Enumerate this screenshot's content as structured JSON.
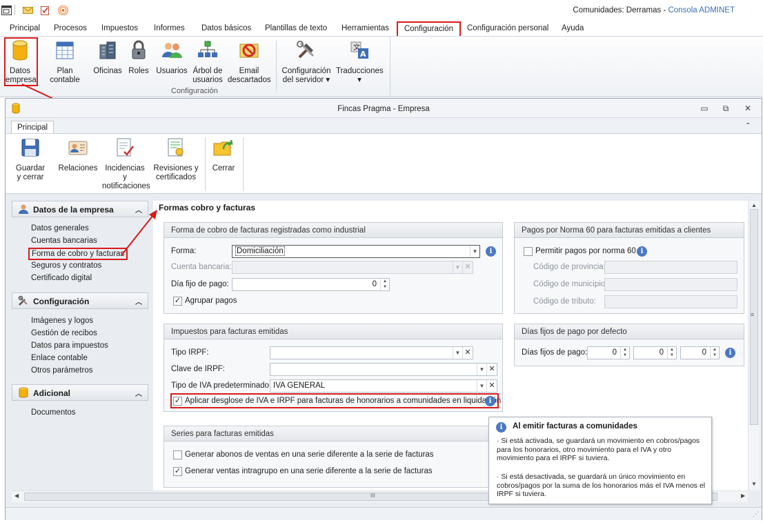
{
  "app": {
    "title_prefix": "Comunidades: Derramas - ",
    "title_app": "Consola ADMINET"
  },
  "menu": [
    "Principal",
    "Procesos",
    "Impuestos",
    "Informes",
    "Datos básicos",
    "Plantillas de texto",
    "Herramientas",
    "Configuración",
    "Configuración personal",
    "Ayuda"
  ],
  "ribbon": {
    "buttons": [
      {
        "l1": "Datos",
        "l2": "empresa"
      },
      {
        "l1": "Plan contable",
        "l2": ""
      },
      {
        "l1": "Oficinas",
        "l2": ""
      },
      {
        "l1": "Roles",
        "l2": ""
      },
      {
        "l1": "Usuarios",
        "l2": ""
      },
      {
        "l1": "Árbol de",
        "l2": "usuarios"
      },
      {
        "l1": "Email",
        "l2": "descartados"
      },
      {
        "l1": "Configuración",
        "l2": "del servidor ▾"
      },
      {
        "l1": "Traducciones",
        "l2": "▾"
      }
    ],
    "group_label": "Configuración"
  },
  "window": {
    "title": "Fincas Pragma - Empresa",
    "tab": "Principal",
    "buttons": [
      {
        "l1": "Guardar",
        "l2": "y cerrar"
      },
      {
        "l1": "Relaciones",
        "l2": ""
      },
      {
        "l1": "Incidencias y",
        "l2": "notificaciones"
      },
      {
        "l1": "Revisiones y",
        "l2": "certificados"
      },
      {
        "l1": "Cerrar",
        "l2": ""
      }
    ]
  },
  "nav": {
    "groups": [
      {
        "title": "Datos de la empresa",
        "items": [
          "Datos generales",
          "Cuentas bancarias",
          "Forma de cobro y facturas",
          "Seguros y contratos",
          "Certificado digital"
        ]
      },
      {
        "title": "Configuración",
        "items": [
          "Imágenes y logos",
          "Gestión de recibos",
          "Datos para impuestos",
          "Enlace contable",
          "Otros parámetros"
        ]
      },
      {
        "title": "Adicional",
        "items": [
          "Documentos"
        ]
      }
    ]
  },
  "content": {
    "section_title": "Formas cobro y facturas",
    "cobro": {
      "title": "Forma de cobro de facturas registradas como industrial",
      "forma_label": "Forma:",
      "forma_value": "Domiciliación",
      "cuenta_label": "Cuenta bancaria:",
      "dia_label": "Día fijo de pago:",
      "dia_value": "0",
      "agrupar_label": "Agrupar pagos",
      "agrupar_checked": true
    },
    "norma60": {
      "title": "Pagos por Norma 60 para facturas emitidas a clientes",
      "permitir_label": "Permitir pagos por norma 60",
      "provincia_label": "Código de provincia:",
      "municipio_label": "Código de municipio:",
      "tributo_label": "Código de tributo:"
    },
    "impuestos": {
      "title": "Impuestos para facturas emitidas",
      "irpf_label": "Tipo IRPF:",
      "clave_label": "Clave de IRPF:",
      "iva_label": "Tipo de IVA predeterminado:",
      "iva_value": "IVA GENERAL",
      "desglose_label": "Aplicar desglose de IVA e IRPF para facturas de honorarios a comunidades en liquidación"
    },
    "dias_fijos": {
      "title": "Días fijos de pago por defecto",
      "label": "Días fijos de pago:",
      "values": [
        "0",
        "0",
        "0"
      ]
    },
    "series": {
      "title": "Series para facturas emitidas",
      "abonos_label": "Generar abonos de ventas en una serie diferente a la serie de facturas",
      "intragrupo_label": "Generar ventas intragrupo en una serie diferente a la serie de facturas"
    }
  },
  "tooltip": {
    "title": "Al emitir facturas a comunidades",
    "p1": "· Si está activada, se guardará un movimiento en cobros/pagos para los honorarios, otro movimiento para el IVA y otro movimiento para el IRPF si tuviera.",
    "p2": "· Si está desactivada, se guardará un único movimiento en cobros/pagos por la suma de los honorarios más el IVA menos el IRPF si tuviera."
  },
  "scroll": {
    "h_grip": "III",
    "v_grip": "≡"
  }
}
